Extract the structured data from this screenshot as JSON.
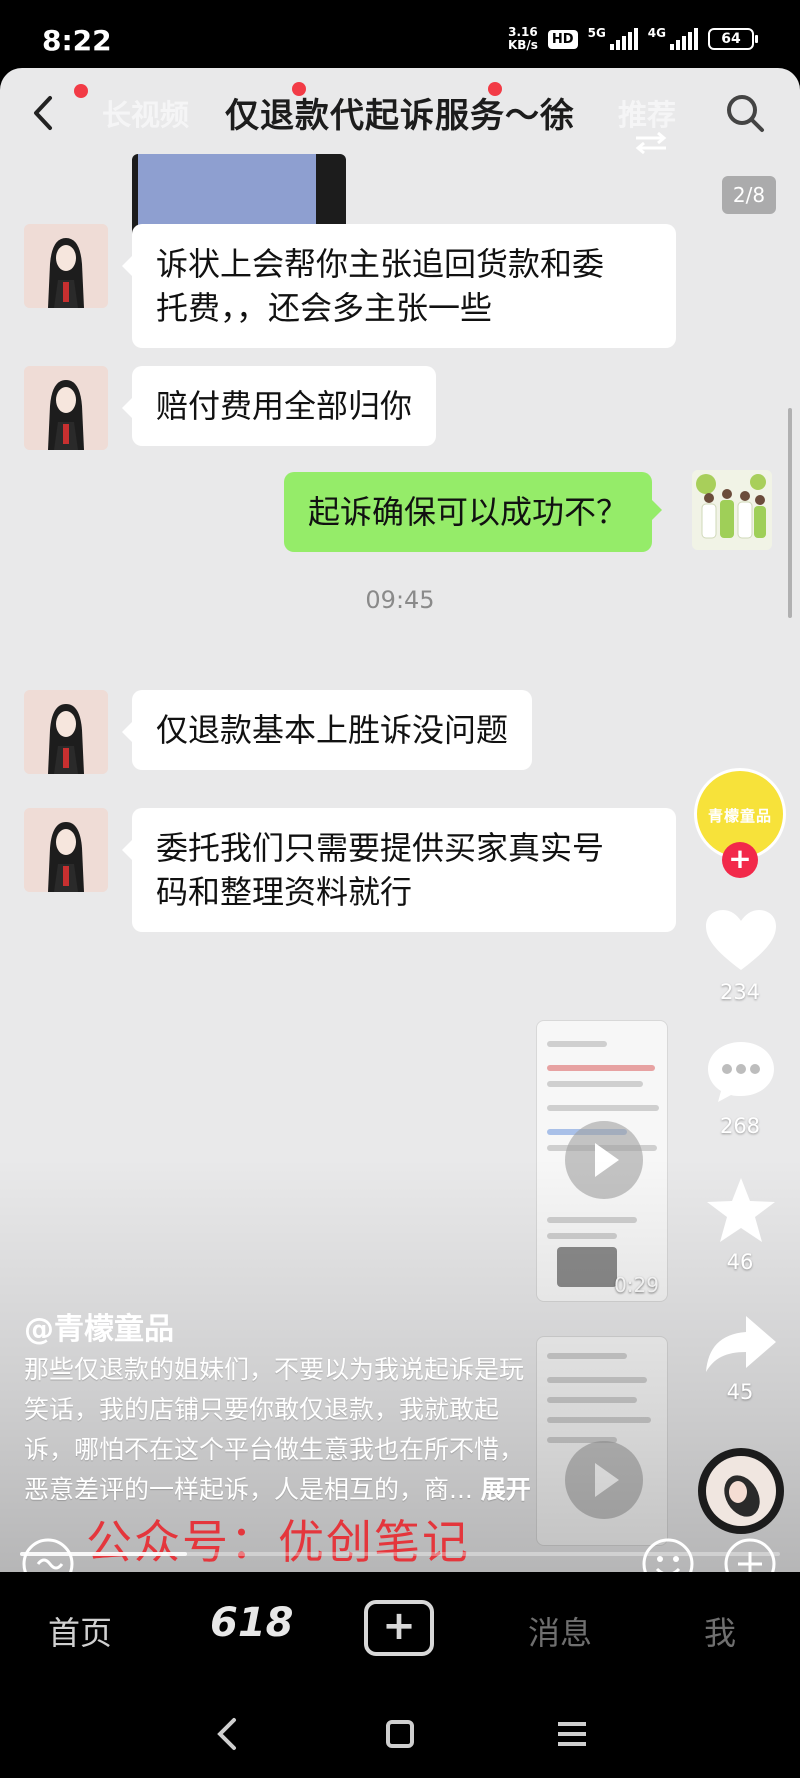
{
  "status_bar": {
    "time": "8:22",
    "net_speed_value": "3.16",
    "net_speed_unit": "KB/s",
    "hd_label": "HD",
    "signal_1_label": "5G",
    "signal_2_label": "4G",
    "battery": "64"
  },
  "header": {
    "title": "仅退款代起诉服务～徐",
    "ghost_tab": "长视频",
    "ghost_tab_2": "推荐",
    "page_indicator": "2/8",
    "icons": [
      "back-arrow-icon",
      "search-icon",
      "shuffle-icon"
    ]
  },
  "chat": {
    "messages": [
      {
        "side": "left",
        "text_line1": "诉状上会帮你主张追回货款和委",
        "text_line2": "托费，，还会多主张一些"
      },
      {
        "side": "left",
        "text": "赔付费用全部归你"
      },
      {
        "side": "right",
        "text": "起诉确保可以成功不？"
      },
      {
        "side": "left",
        "text": "仅退款基本上胜诉没问题"
      },
      {
        "side": "left",
        "text_line1": "委托我们只需要提供买家真实号",
        "text_line2": "码和整理资料就行"
      }
    ],
    "timestamp": "09:45"
  },
  "actions": {
    "creator_logo_text": "青檬童品",
    "like_count": "234",
    "comment_count": "268",
    "favorite_count": "46",
    "share_count": "45",
    "icons": [
      "heart-icon",
      "comment-icon",
      "star-icon",
      "share-icon",
      "music-disc-icon"
    ]
  },
  "video_thumbs": {
    "thumb1_duration": "0:29"
  },
  "caption": {
    "author": "@青檬童品",
    "line1": "那些仅退款的姐妹们，不要以为我说起诉是玩",
    "line2": "笑话，我的店铺只要你敢仅退款，我就敢起",
    "line3": "诉，哪怕不在这个平台做生意我也在所不惜，",
    "line4": "恶意差评的一样起诉，人是相互的，商...",
    "expand": "展开",
    "watermark": "公众号：优创笔记",
    "progress": 0.22
  },
  "bottom_nav": {
    "home": "首页",
    "promo": "618",
    "add": "+",
    "messages": "消息",
    "me": "我"
  },
  "colors": {
    "green_bubble": "#95ec69",
    "accent_red": "#f2294a",
    "creator_yellow": "#f7e23a",
    "watermark_red": "#e4363c"
  }
}
